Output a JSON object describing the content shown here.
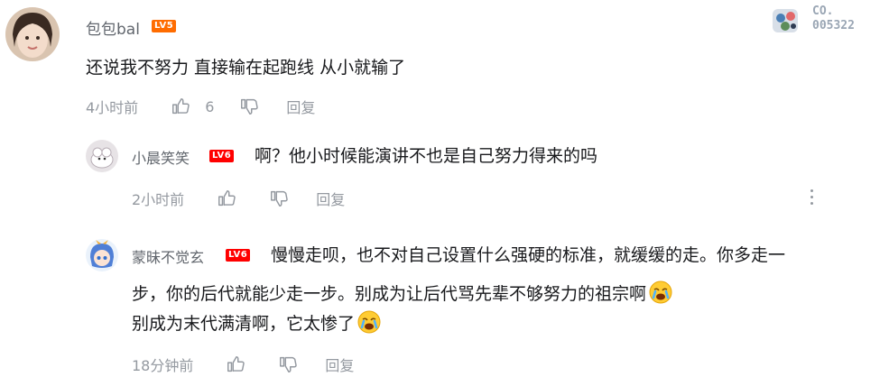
{
  "comment": {
    "username": "包包bal",
    "level": "LV5",
    "text": "还说我不努力 直接输在起跑线 从小就输了",
    "time": "4小时前",
    "likes": "6",
    "reply_label": "回复",
    "badge": {
      "line1": "CO.",
      "line2": "005322"
    }
  },
  "replies": [
    {
      "username": "小晨笑笑",
      "level": "LV6",
      "text": "啊？他小时候能演讲不也是自己努力得来的吗",
      "time": "2小时前",
      "reply_label": "回复"
    },
    {
      "username": "蒙昧不觉玄",
      "level": "LV6",
      "text_line1": "慢慢走呗，也不对自己设置什么强硬的标准，就缓缓的走。你多走一",
      "text_line2": "步，你的后代就能少走一步。别成为让后代骂先辈不够努力的祖宗啊",
      "text_line3": "别成为末代满清啊，它太惨了",
      "time": "18分钟前",
      "reply_label": "回复"
    }
  ],
  "colors": {
    "level5": "#ff6c00",
    "level6": "#ff0000",
    "meta": "#9499a0"
  },
  "icons": [
    "thumbs-up-icon",
    "thumbs-down-icon",
    "more-vertical-icon",
    "crying-emoji"
  ]
}
